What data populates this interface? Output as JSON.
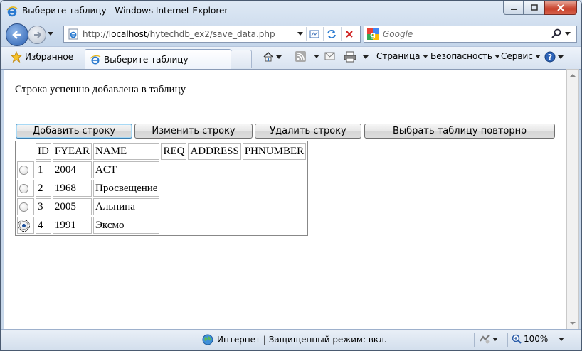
{
  "window": {
    "title": "Выберите таблицу - Windows Internet Explorer"
  },
  "navigation": {
    "address_host": "localhost",
    "address_path": "/hytechdb_ex2/save_data.php",
    "address_scheme": "http://",
    "search_placeholder": "Google"
  },
  "command_bar": {
    "favorites_label": "Избранное",
    "tab_label": "Выберите таблицу",
    "page_menu": "Страница",
    "safety_menu": "Безопасность",
    "tools_menu": "Сервис"
  },
  "page": {
    "message": "Строка успешно добавлена в таблицу",
    "buttons": {
      "add_row": "Добавить строку",
      "edit_row": "Изменить строку",
      "delete_row": "Удалить строку",
      "reselect_table": "Выбрать таблицу повторно"
    },
    "table": {
      "columns": [
        "ID",
        "FYEAR",
        "NAME",
        "REQ",
        "ADDRESS",
        "PHNUMBER"
      ],
      "rows": [
        {
          "id": "1",
          "fyear": "2004",
          "name": "ACT",
          "selected": false
        },
        {
          "id": "2",
          "fyear": "1968",
          "name": "Просвещение",
          "selected": false
        },
        {
          "id": "3",
          "fyear": "2005",
          "name": "Альпина",
          "selected": false
        },
        {
          "id": "4",
          "fyear": "1991",
          "name": "Эксмо",
          "selected": true
        }
      ]
    }
  },
  "status_bar": {
    "zone_text": "Интернет | Защищенный режим: вкл.",
    "zoom": "100%"
  },
  "colors": {
    "chrome_blue": "#c5d6ea",
    "close_red": "#c8412b",
    "link_blue": "#1b4e9a"
  }
}
